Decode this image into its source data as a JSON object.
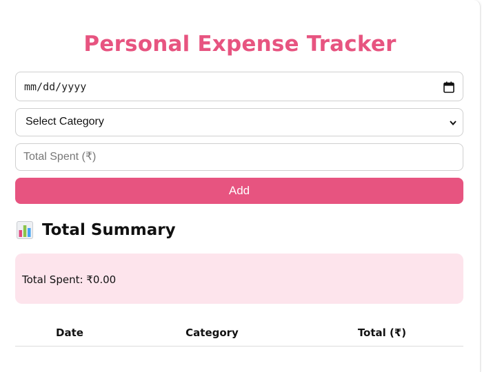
{
  "title": "Personal Expense Tracker",
  "form": {
    "date_placeholder": "mm/dd/yyyy",
    "category_selected": "Select Category",
    "amount_placeholder": "Total Spent (₹)",
    "add_label": "Add"
  },
  "summary": {
    "icon": "bar-chart-icon",
    "heading": "Total Summary",
    "total_label": "Total Spent: ₹0.00"
  },
  "table": {
    "columns": [
      "Date",
      "Category",
      "Total (₹)"
    ]
  },
  "colors": {
    "accent": "#e75480",
    "summary_background": "#fde4ec"
  }
}
